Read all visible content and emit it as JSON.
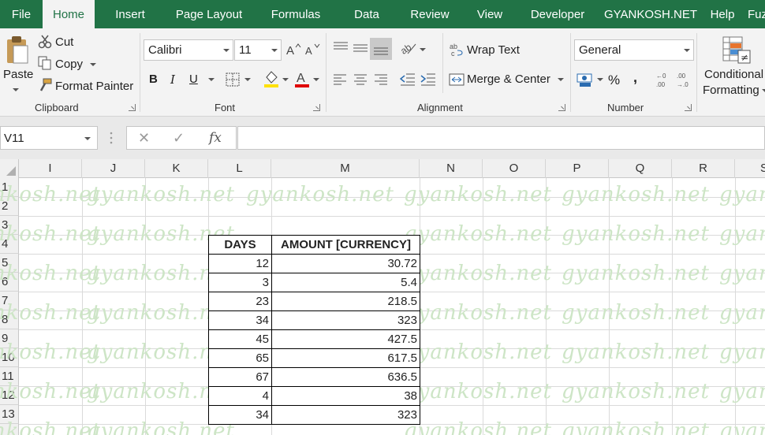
{
  "ribbon_tabs": [
    "File",
    "Home",
    "Insert",
    "Page Layout",
    "Formulas",
    "Data",
    "Review",
    "View",
    "Developer",
    "GYANKOSH.NET",
    "Help",
    "Fuzzy Lookup"
  ],
  "active_tab": "Home",
  "clipboard": {
    "paste": "Paste",
    "cut": "Cut",
    "copy": "Copy",
    "format_painter": "Format Painter",
    "label": "Clipboard"
  },
  "font": {
    "name": "Calibri",
    "size": "11",
    "bold": "B",
    "italic": "I",
    "underline": "U",
    "label": "Font"
  },
  "alignment": {
    "wrap_text": "Wrap Text",
    "merge_center": "Merge & Center",
    "label": "Alignment"
  },
  "number": {
    "format": "General",
    "percent": "%",
    "comma": ",",
    "label": "Number"
  },
  "styles": {
    "conditional_1": "Conditional",
    "conditional_2": "Formatting"
  },
  "formula_bar": {
    "name_box": "V11",
    "cancel": "✕",
    "enter": "✓",
    "fx": "fx",
    "formula": ""
  },
  "columns": [
    "I",
    "J",
    "K",
    "L",
    "M",
    "N",
    "O",
    "P",
    "Q",
    "R",
    "S"
  ],
  "rows": [
    "1",
    "2",
    "3",
    "4",
    "5",
    "6",
    "7",
    "8",
    "9",
    "10",
    "11",
    "12",
    "13"
  ],
  "watermark": "gyankosh.net",
  "table": {
    "headers": [
      "DAYS",
      "AMOUNT [CURRENCY]"
    ],
    "rows": [
      [
        "12",
        "30.72"
      ],
      [
        "3",
        "5.4"
      ],
      [
        "23",
        "218.5"
      ],
      [
        "34",
        "323"
      ],
      [
        "45",
        "427.5"
      ],
      [
        "65",
        "617.5"
      ],
      [
        "67",
        "636.5"
      ],
      [
        "4",
        "38"
      ],
      [
        "34",
        "323"
      ]
    ]
  },
  "colors": {
    "excel_green": "#217346",
    "ribbon_bg": "#f3f3f3",
    "watermark": "#cde5c6"
  }
}
